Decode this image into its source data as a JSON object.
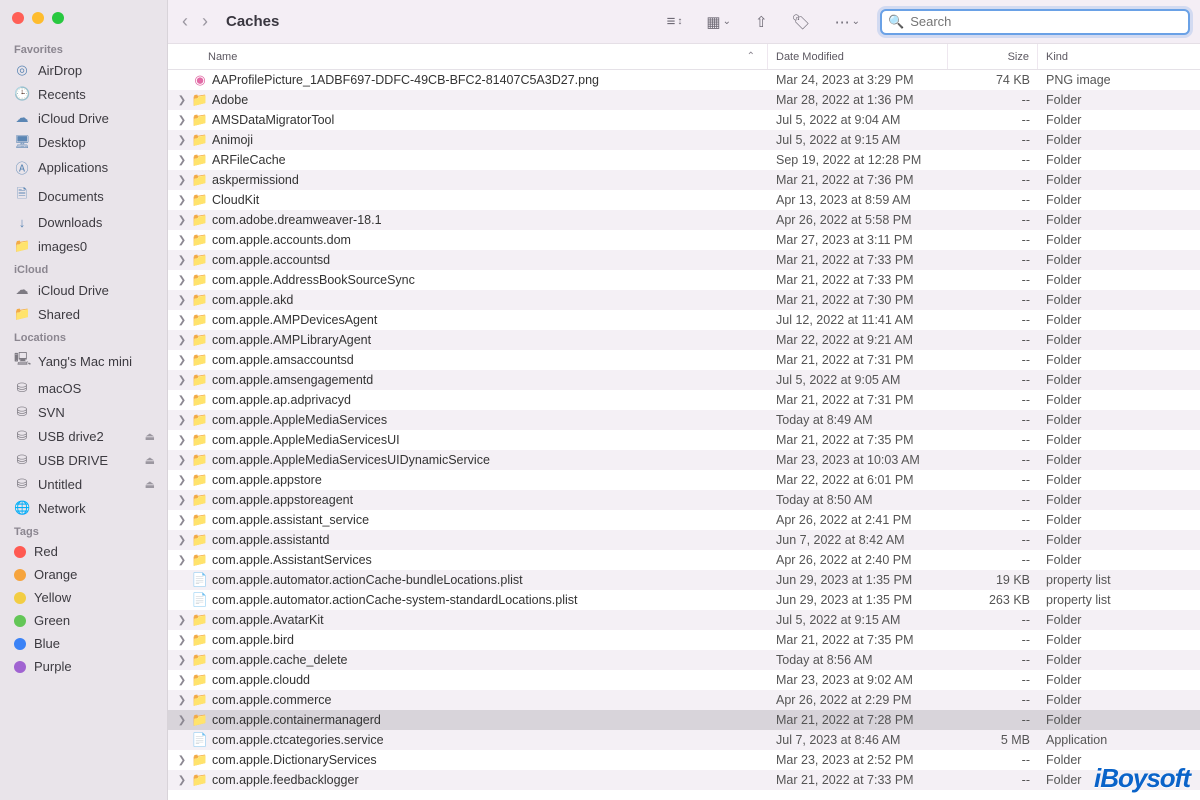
{
  "window": {
    "title": "Caches"
  },
  "search": {
    "placeholder": "Search"
  },
  "columns": {
    "name": "Name",
    "date": "Date Modified",
    "size": "Size",
    "kind": "Kind"
  },
  "sidebar": {
    "sections": [
      {
        "label": "Favorites",
        "items": [
          {
            "icon": "airdrop",
            "label": "AirDrop"
          },
          {
            "icon": "clock",
            "label": "Recents"
          },
          {
            "icon": "cloud",
            "label": "iCloud Drive"
          },
          {
            "icon": "desktop",
            "label": "Desktop"
          },
          {
            "icon": "app",
            "label": "Applications"
          },
          {
            "icon": "doc",
            "label": "Documents"
          },
          {
            "icon": "down",
            "label": "Downloads"
          },
          {
            "icon": "folder",
            "label": "images0"
          }
        ]
      },
      {
        "label": "iCloud",
        "items": [
          {
            "icon": "cloud",
            "label": "iCloud Drive"
          },
          {
            "icon": "shared",
            "label": "Shared"
          }
        ]
      },
      {
        "label": "Locations",
        "items": [
          {
            "icon": "mac",
            "label": "Yang's Mac mini"
          },
          {
            "icon": "disk",
            "label": "macOS"
          },
          {
            "icon": "disk",
            "label": "SVN"
          },
          {
            "icon": "disk",
            "label": "USB drive2",
            "eject": true
          },
          {
            "icon": "disk",
            "label": "USB DRIVE",
            "eject": true
          },
          {
            "icon": "disk",
            "label": "Untitled",
            "eject": true
          },
          {
            "icon": "net",
            "label": "Network"
          }
        ]
      },
      {
        "label": "Tags",
        "items": [
          {
            "tag": "#ff5a52",
            "label": "Red"
          },
          {
            "tag": "#f6a43d",
            "label": "Orange"
          },
          {
            "tag": "#f2cd43",
            "label": "Yellow"
          },
          {
            "tag": "#63c657",
            "label": "Green"
          },
          {
            "tag": "#3b82f6",
            "label": "Blue"
          },
          {
            "tag": "#a063d1",
            "label": "Purple"
          }
        ]
      }
    ]
  },
  "files": [
    {
      "type": "png",
      "name": "AAProfilePicture_1ADBF697-DDFC-49CB-BFC2-81407C5A3D27.png",
      "date": "Mar 24, 2023 at 3:29 PM",
      "size": "74 KB",
      "kind": "PNG image"
    },
    {
      "type": "folder",
      "name": "Adobe",
      "date": "Mar 28, 2022 at 1:36 PM",
      "size": "--",
      "kind": "Folder"
    },
    {
      "type": "folder",
      "name": "AMSDataMigratorTool",
      "date": "Jul 5, 2022 at 9:04 AM",
      "size": "--",
      "kind": "Folder"
    },
    {
      "type": "folder",
      "name": "Animoji",
      "date": "Jul 5, 2022 at 9:15 AM",
      "size": "--",
      "kind": "Folder"
    },
    {
      "type": "folder",
      "name": "ARFileCache",
      "date": "Sep 19, 2022 at 12:28 PM",
      "size": "--",
      "kind": "Folder"
    },
    {
      "type": "folder",
      "name": "askpermissiond",
      "date": "Mar 21, 2022 at 7:36 PM",
      "size": "--",
      "kind": "Folder"
    },
    {
      "type": "folder",
      "name": "CloudKit",
      "date": "Apr 13, 2023 at 8:59 AM",
      "size": "--",
      "kind": "Folder"
    },
    {
      "type": "folder",
      "name": "com.adobe.dreamweaver-18.1",
      "date": "Apr 26, 2022 at 5:58 PM",
      "size": "--",
      "kind": "Folder"
    },
    {
      "type": "folder",
      "name": "com.apple.accounts.dom",
      "date": "Mar 27, 2023 at 3:11 PM",
      "size": "--",
      "kind": "Folder"
    },
    {
      "type": "folder",
      "name": "com.apple.accountsd",
      "date": "Mar 21, 2022 at 7:33 PM",
      "size": "--",
      "kind": "Folder"
    },
    {
      "type": "folder",
      "name": "com.apple.AddressBookSourceSync",
      "date": "Mar 21, 2022 at 7:33 PM",
      "size": "--",
      "kind": "Folder"
    },
    {
      "type": "folder",
      "name": "com.apple.akd",
      "date": "Mar 21, 2022 at 7:30 PM",
      "size": "--",
      "kind": "Folder"
    },
    {
      "type": "folder",
      "name": "com.apple.AMPDevicesAgent",
      "date": "Jul 12, 2022 at 11:41 AM",
      "size": "--",
      "kind": "Folder"
    },
    {
      "type": "folder",
      "name": "com.apple.AMPLibraryAgent",
      "date": "Mar 22, 2022 at 9:21 AM",
      "size": "--",
      "kind": "Folder"
    },
    {
      "type": "folder",
      "name": "com.apple.amsaccountsd",
      "date": "Mar 21, 2022 at 7:31 PM",
      "size": "--",
      "kind": "Folder"
    },
    {
      "type": "folder",
      "name": "com.apple.amsengagementd",
      "date": "Jul 5, 2022 at 9:05 AM",
      "size": "--",
      "kind": "Folder"
    },
    {
      "type": "folder",
      "name": "com.apple.ap.adprivacyd",
      "date": "Mar 21, 2022 at 7:31 PM",
      "size": "--",
      "kind": "Folder"
    },
    {
      "type": "folder",
      "name": "com.apple.AppleMediaServices",
      "date": "Today at 8:49 AM",
      "size": "--",
      "kind": "Folder"
    },
    {
      "type": "folder",
      "name": "com.apple.AppleMediaServicesUI",
      "date": "Mar 21, 2022 at 7:35 PM",
      "size": "--",
      "kind": "Folder"
    },
    {
      "type": "folder",
      "name": "com.apple.AppleMediaServicesUIDynamicService",
      "date": "Mar 23, 2023 at 10:03 AM",
      "size": "--",
      "kind": "Folder"
    },
    {
      "type": "folder",
      "name": "com.apple.appstore",
      "date": "Mar 22, 2022 at 6:01 PM",
      "size": "--",
      "kind": "Folder"
    },
    {
      "type": "folder",
      "name": "com.apple.appstoreagent",
      "date": "Today at 8:50 AM",
      "size": "--",
      "kind": "Folder"
    },
    {
      "type": "folder",
      "name": "com.apple.assistant_service",
      "date": "Apr 26, 2022 at 2:41 PM",
      "size": "--",
      "kind": "Folder"
    },
    {
      "type": "folder",
      "name": "com.apple.assistantd",
      "date": "Jun 7, 2022 at 8:42 AM",
      "size": "--",
      "kind": "Folder"
    },
    {
      "type": "folder",
      "name": "com.apple.AssistantServices",
      "date": "Apr 26, 2022 at 2:40 PM",
      "size": "--",
      "kind": "Folder"
    },
    {
      "type": "plist",
      "name": "com.apple.automator.actionCache-bundleLocations.plist",
      "date": "Jun 29, 2023 at 1:35 PM",
      "size": "19 KB",
      "kind": "property list"
    },
    {
      "type": "plist",
      "name": "com.apple.automator.actionCache-system-standardLocations.plist",
      "date": "Jun 29, 2023 at 1:35 PM",
      "size": "263 KB",
      "kind": "property list"
    },
    {
      "type": "folder",
      "name": "com.apple.AvatarKit",
      "date": "Jul 5, 2022 at 9:15 AM",
      "size": "--",
      "kind": "Folder"
    },
    {
      "type": "folder",
      "name": "com.apple.bird",
      "date": "Mar 21, 2022 at 7:35 PM",
      "size": "--",
      "kind": "Folder"
    },
    {
      "type": "folder",
      "name": "com.apple.cache_delete",
      "date": "Today at 8:56 AM",
      "size": "--",
      "kind": "Folder"
    },
    {
      "type": "folder",
      "name": "com.apple.cloudd",
      "date": "Mar 23, 2023 at 9:02 AM",
      "size": "--",
      "kind": "Folder"
    },
    {
      "type": "folder",
      "name": "com.apple.commerce",
      "date": "Apr 26, 2022 at 2:29 PM",
      "size": "--",
      "kind": "Folder"
    },
    {
      "type": "folder",
      "name": "com.apple.containermanagerd",
      "date": "Mar 21, 2022 at 7:28 PM",
      "size": "--",
      "kind": "Folder",
      "selected": true
    },
    {
      "type": "app",
      "name": "com.apple.ctcategories.service",
      "date": "Jul 7, 2023 at 8:46 AM",
      "size": "5 MB",
      "kind": "Application"
    },
    {
      "type": "folder",
      "name": "com.apple.DictionaryServices",
      "date": "Mar 23, 2023 at 2:52 PM",
      "size": "--",
      "kind": "Folder"
    },
    {
      "type": "folder",
      "name": "com.apple.feedbacklogger",
      "date": "Mar 21, 2022 at 7:33 PM",
      "size": "--",
      "kind": "Folder"
    }
  ],
  "watermark": "iBoysoft"
}
